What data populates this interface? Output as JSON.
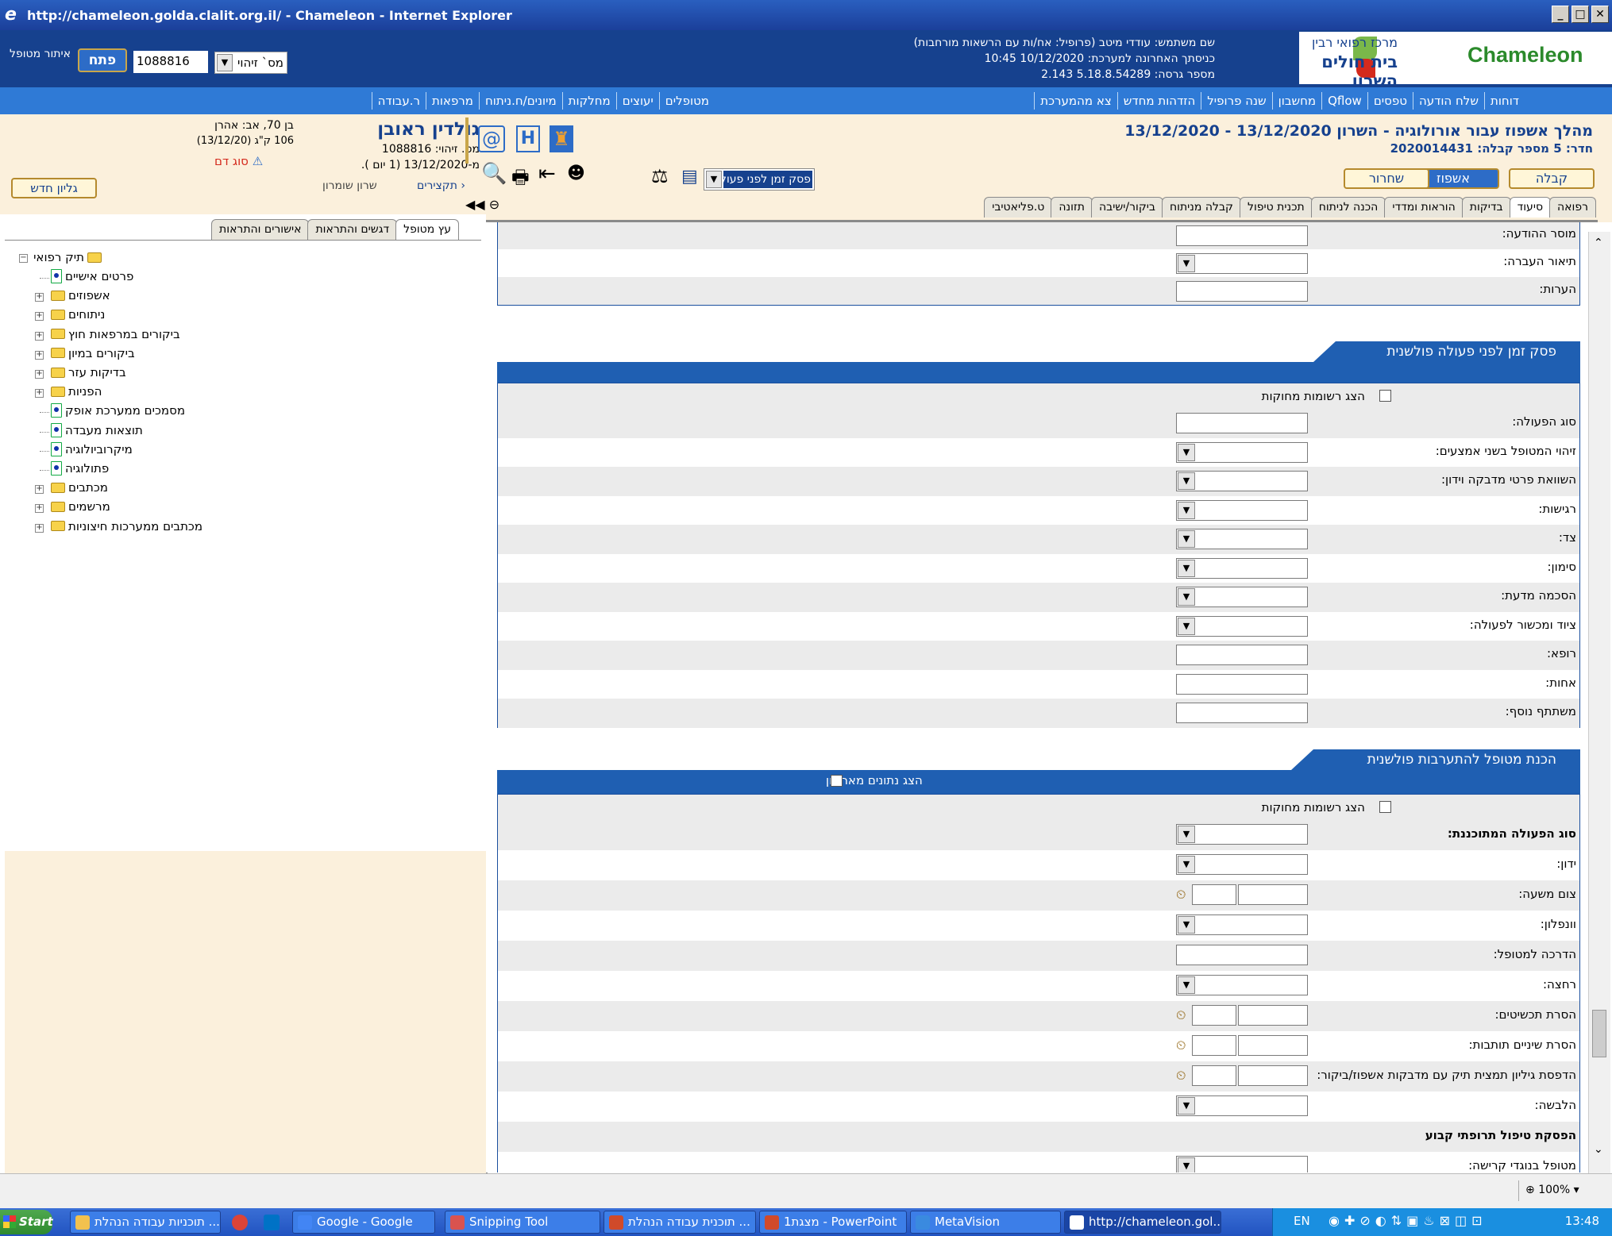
{
  "window": {
    "title": "http://chameleon.golda.clalit.org.il/ - Chameleon - Internet Explorer"
  },
  "top": {
    "patient_search_label": "איתור מטופל",
    "id_type": "מס` זיהוי",
    "id_value": "1088816",
    "open_button": "פתח",
    "user_line": "שם משתמש: עודדי מיטב (פרופיל: אח/ות עם הרשאות מורחבות)",
    "last_login": "כניסתך האחרונה למערכת: 10/12/2020 10:45",
    "version": "מספר גרסה: 5.18.8.54289   2.143",
    "logo_text": "Chameleon",
    "hospital_line1": "מרכז רפואי רבין",
    "hospital_line2": "בית חולים השרון"
  },
  "nav_right": [
    "דוחות",
    "שלח הודעה",
    "טפסים",
    "Qflow",
    "מחשבון",
    "שנה פרופיל",
    "הזדהות מחדש",
    "צא מהמערכת"
  ],
  "nav_left": [
    "מטופלים",
    "יעוצים",
    "מחלקות",
    "מיונים/ח.ניתוח",
    "מרפאות",
    "ר.עבודה"
  ],
  "patient": {
    "name": "גולדין ראובן",
    "id_line": "מס. זיהוי: 1088816",
    "since": "מ-13/12/2020 (1 יום ).",
    "age": "בן 70,  אב: אהרן",
    "weight": "106 ק\"ג (13/12/20)",
    "blood": "סוג דם",
    "link_summaries": "תקצירים",
    "doctor": "שרון שומרון",
    "new_sheet_button": "גליון חדש"
  },
  "left_tabs": [
    "עץ מטופל",
    "דגשים והתראות",
    "אישורים והתראות"
  ],
  "tree": {
    "root": "תיק רפואי",
    "items": [
      {
        "label": "פרטים אישיים",
        "kind": "doc"
      },
      {
        "label": "אשפוזים",
        "kind": "folder"
      },
      {
        "label": "ניתוחים",
        "kind": "folder"
      },
      {
        "label": "ביקורים במרפאות חוץ",
        "kind": "folder"
      },
      {
        "label": "ביקורים במיון",
        "kind": "folder"
      },
      {
        "label": "בדיקות עזר",
        "kind": "folder"
      },
      {
        "label": "הפניות",
        "kind": "folder"
      },
      {
        "label": "מסמכים ממערכת אופק",
        "kind": "doc"
      },
      {
        "label": "תוצאות מעבדה",
        "kind": "doc"
      },
      {
        "label": "מיקרוביולוגיה",
        "kind": "doc"
      },
      {
        "label": "פתולוגיה",
        "kind": "doc"
      },
      {
        "label": "מכתבים",
        "kind": "folder"
      },
      {
        "label": "מרשמים",
        "kind": "folder"
      },
      {
        "label": "מכתבים ממערכות חיצוניות",
        "kind": "folder"
      }
    ]
  },
  "encounter": {
    "title": "מהלך אשפוז עבור אורולוגיה - השרון 13/12/2020 - 13/12/2020",
    "subtitle": "חדר: 5 מספר קבלה: 2020014431",
    "btn_admit": "קבלה",
    "btn_hosp": "אשפוז",
    "btn_release": "שחרור",
    "form_select": "פסק זמן לפני פעולה"
  },
  "main_tabs": [
    "רפואה",
    "סיעוד",
    "בדיקות",
    "הוראות ומדדי",
    "הכנה לניתוח",
    "תכנית טיפול",
    "קבלה מניתוח",
    "ביקור/ישיבה",
    "תזונה",
    "ט.פליאטיבי"
  ],
  "section0": {
    "rows": [
      "מוסר ההודעה:",
      "תיאור העברה:",
      "הערות:"
    ]
  },
  "section1": {
    "title": "פסק זמן לפני פעולה פולשנית",
    "show_deleted": "הצג רשומות מחוקות",
    "rows": [
      "סוג הפעולה:",
      "זיהוי המטופל בשני אמצעים:",
      "השוואת פרטי מדבקה וידון:",
      "רגישות:",
      "צד:",
      "סימון:",
      "הסכמה מדעת:",
      "ציוד ומכשור לפעולה:",
      "רופא:",
      "אחות:",
      "משתתף נוסף:"
    ]
  },
  "section2": {
    "title": "הכנת מטופל להתערבות פולשנית",
    "show_archive": "הצג נתונים מארכיון",
    "show_deleted": "הצג רשומות מחוקות",
    "rows": [
      "סוג הפעולה המתוכננת:",
      "ידון:",
      "צום משעה:",
      "וונפלון:",
      "הדרכה למטופל:",
      "רחצה:",
      "הסרת תכשיטים:",
      "הסרת שיניים תותבות:",
      "הדפסת גיליון תמצית תיק עם מדבקות אשפוז/ביקור:",
      "הלבשה:",
      "הפסקת טיפול תרופתי קבוע",
      "מטופל בנוגדי קרישה:"
    ]
  },
  "status": {
    "zoom": "100%"
  },
  "taskbar": {
    "start": "Start",
    "tasks": [
      "תוכניות עבודה הנהלת ...",
      "Google - Google",
      "Snipping Tool",
      "תוכנית עבודה הנהלת ...",
      "מצגת1 - PowerPoint",
      "MetaVision",
      "http://chameleon.gol..."
    ],
    "lang": "EN",
    "clock": "13:48"
  },
  "colors": {
    "brand_blue": "#16418e",
    "nav_blue": "#2f7ad6",
    "section_blue": "#1f5fb2",
    "cream": "#fbf0dc"
  }
}
